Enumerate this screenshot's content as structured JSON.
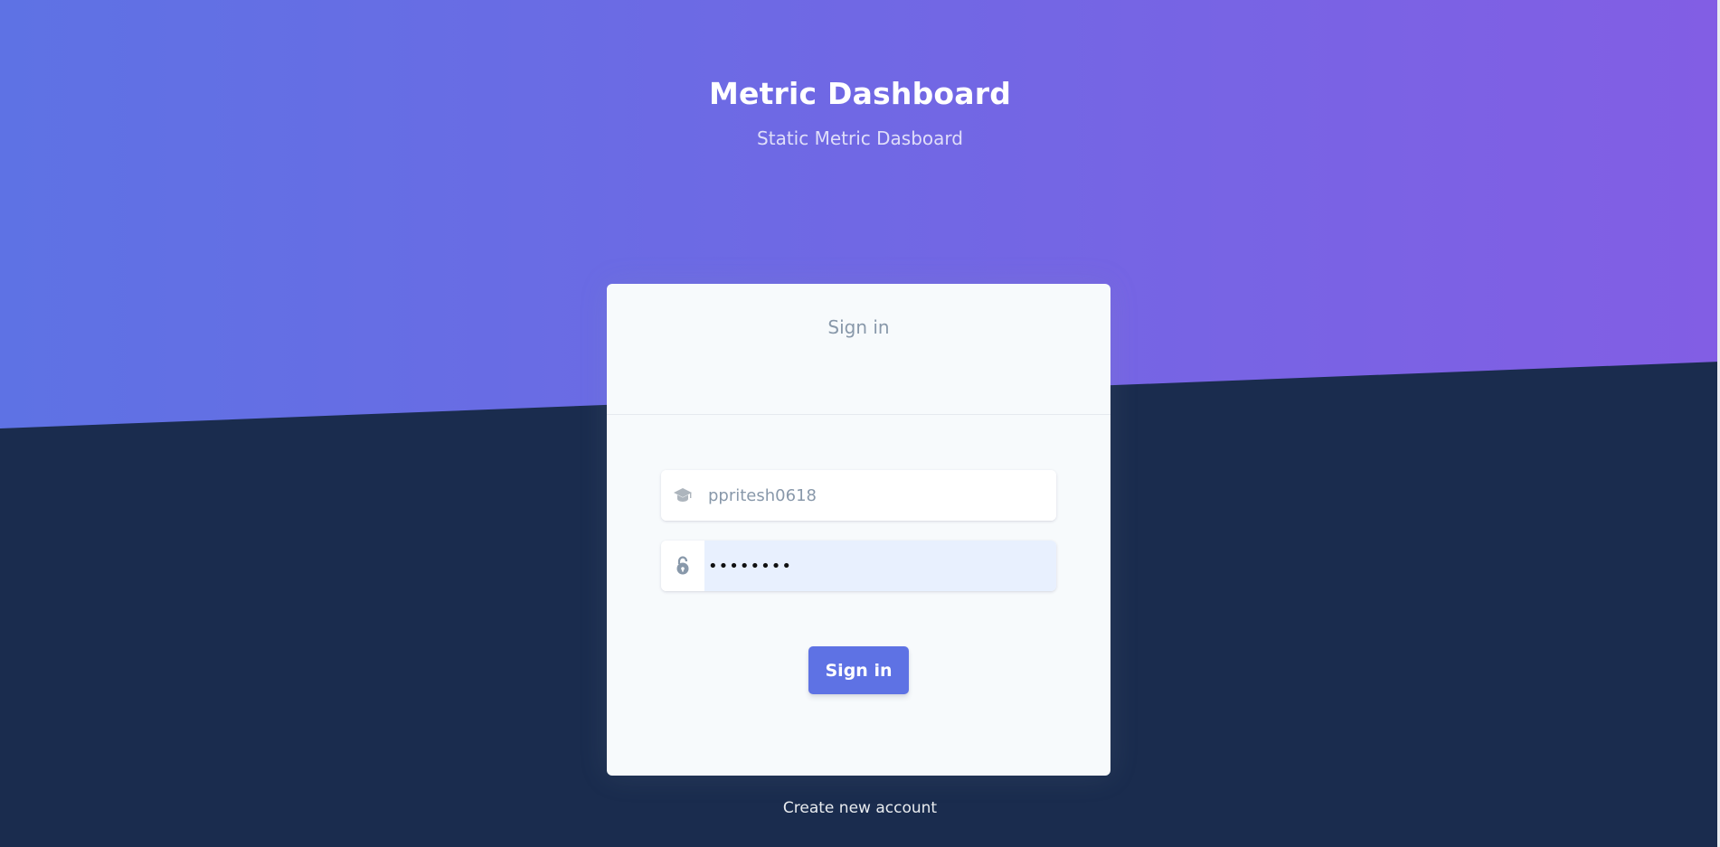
{
  "header": {
    "title": "Metric Dashboard",
    "subtitle": "Static Metric Dasboard"
  },
  "card": {
    "header_text": "Sign in",
    "username": {
      "value": "ppritesh0618",
      "icon": "graduation-cap-icon"
    },
    "password": {
      "value": "••••••••",
      "icon": "unlock-icon"
    },
    "submit_label": "Sign in"
  },
  "footer": {
    "create_account_label": "Create new account"
  },
  "colors": {
    "gradient_start": "#5e72e4",
    "gradient_end": "#825ee4",
    "background_dark": "#1a2c4e",
    "primary": "#5e72e4",
    "card_bg": "#f7fafc"
  }
}
